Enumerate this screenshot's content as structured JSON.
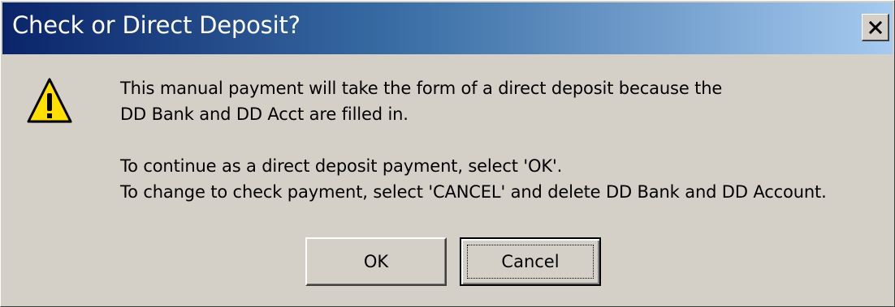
{
  "dialog": {
    "title": "Check or Direct Deposit?",
    "close_icon": "close-icon",
    "warning_icon": "warning-icon",
    "message": {
      "line1": "This manual payment will take the form of a direct deposit because the",
      "line2": "DD Bank and DD Acct are filled in.",
      "line3": "To continue as a direct deposit payment, select 'OK'.",
      "line4": "To change to check payment, select 'CANCEL' and delete DD Bank and DD Account."
    },
    "buttons": {
      "ok_label": "OK",
      "cancel_label": "Cancel"
    },
    "colors": {
      "titlebar_start": "#0a246a",
      "titlebar_end": "#a6caf0",
      "face": "#d4d0c8",
      "warning_yellow": "#ffde00"
    }
  }
}
